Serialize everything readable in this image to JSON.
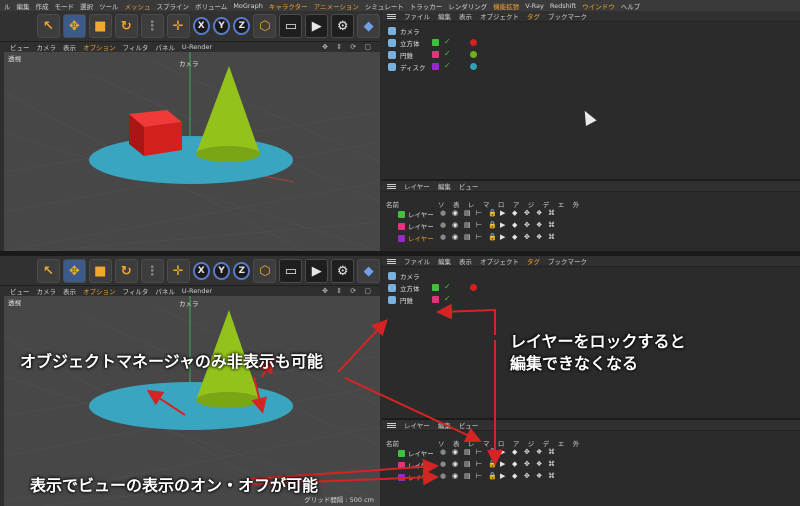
{
  "menubar": [
    {
      "label": "ル",
      "hl": false
    },
    {
      "label": "編集",
      "hl": false
    },
    {
      "label": "作成",
      "hl": false
    },
    {
      "label": "モード",
      "hl": false
    },
    {
      "label": "選択",
      "hl": false
    },
    {
      "label": "ツール",
      "hl": false
    },
    {
      "label": "メッシュ",
      "hl": true
    },
    {
      "label": "スプライン",
      "hl": false
    },
    {
      "label": "ボリューム",
      "hl": false
    },
    {
      "label": "MoGraph",
      "hl": false
    },
    {
      "label": "キャラクター",
      "hl": true
    },
    {
      "label": "アニメーション",
      "hl": true
    },
    {
      "label": "シミュレート",
      "hl": false
    },
    {
      "label": "トラッカー",
      "hl": false
    },
    {
      "label": "レンダリング",
      "hl": false
    },
    {
      "label": "機能拡張",
      "hl": true
    },
    {
      "label": "V-Ray",
      "hl": false
    },
    {
      "label": "Redshift",
      "hl": false
    },
    {
      "label": "ウインドウ",
      "hl": true
    },
    {
      "label": "ヘルプ",
      "hl": false
    }
  ],
  "view_menu": [
    {
      "label": "ビュー",
      "hl": false
    },
    {
      "label": "カメラ",
      "hl": false
    },
    {
      "label": "表示",
      "hl": false
    },
    {
      "label": "オプション",
      "hl": true
    },
    {
      "label": "フィルタ",
      "hl": false
    },
    {
      "label": "パネル",
      "hl": false
    },
    {
      "label": "U-Render",
      "hl": false
    }
  ],
  "viewport": {
    "mode_label": "透視",
    "camera_label": "カメラ",
    "grid_note": "グリッド間隔 : 500 cm"
  },
  "object_manager": {
    "menu": [
      {
        "label": "ファイル",
        "hl": false
      },
      {
        "label": "編集",
        "hl": false
      },
      {
        "label": "表示",
        "hl": false
      },
      {
        "label": "オブジェクト",
        "hl": false
      },
      {
        "label": "タグ",
        "hl": true
      },
      {
        "label": "ブックマーク",
        "hl": false
      }
    ],
    "top_objects": [
      {
        "name": "カメラ",
        "layer": "",
        "tag": ""
      },
      {
        "name": "立方体",
        "layer": "#3ec23e",
        "tag": "#d62020"
      },
      {
        "name": "円錐",
        "layer": "#e0357e",
        "tag": "#6fae1f"
      },
      {
        "name": "ディスク",
        "layer": "#9a27c9",
        "tag": "#2fa2b8"
      }
    ],
    "bottom_objects": [
      {
        "name": "カメラ",
        "layer": "",
        "tag": ""
      },
      {
        "name": "立方体",
        "layer": "#3ec23e",
        "tag": "#d62020"
      },
      {
        "name": "円錐",
        "layer": "#e0357e",
        "tag": ""
      }
    ]
  },
  "layer_manager": {
    "menu": [
      {
        "label": "レイヤー",
        "hl": false
      },
      {
        "label": "編集",
        "hl": false
      },
      {
        "label": "ビュー",
        "hl": false
      }
    ],
    "name_header": "名前",
    "col_headers": "ソ 表 レ マ ロ ア ジ デ エ 外",
    "layers": [
      {
        "name": "レイヤー",
        "color": "#3ec23e",
        "text_color": "#dcdcdc"
      },
      {
        "name": "レイヤー",
        "color": "#e0357e",
        "text_color": "#dcdcdc"
      },
      {
        "name": "レイヤー",
        "color": "#9a27c9",
        "text_color": "#f2a22f"
      }
    ]
  },
  "annotations": {
    "hide_in_manager": "オブジェクトマネージャのみ非表示も可能",
    "lock_line1": "レイヤーをロックすると",
    "lock_line2": "編集できなくなる",
    "view_toggle": "表示でビューの表示のオン・オフが可能"
  },
  "colors": {
    "accent": "#f2a22f",
    "arrow": "#d42424",
    "cube": "#d41f1f",
    "cone": "#93c21c",
    "disc": "#39a5c0"
  }
}
